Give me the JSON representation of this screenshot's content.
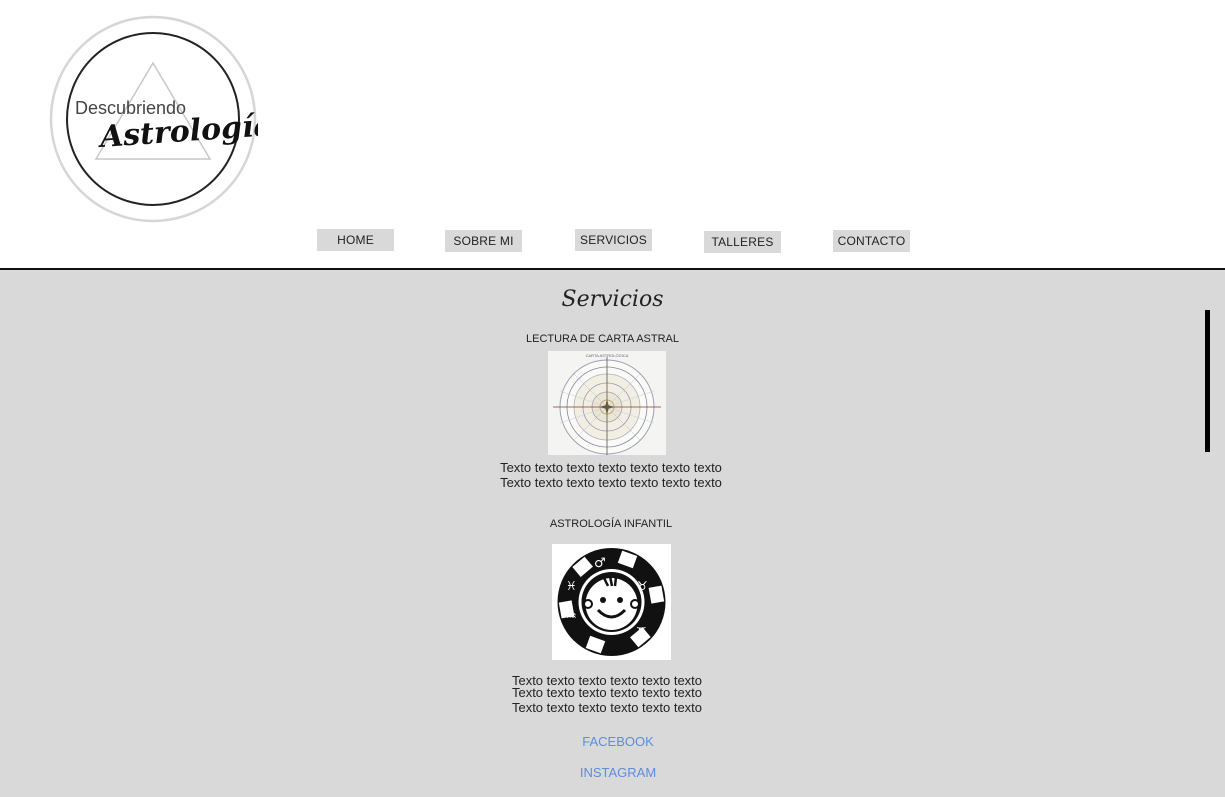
{
  "nav": {
    "items": [
      {
        "label": "HOME"
      },
      {
        "label": "SOBRE MI"
      },
      {
        "label": "SERVICIOS"
      },
      {
        "label": "TALLERES"
      },
      {
        "label": "CONTACTO"
      }
    ]
  },
  "main": {
    "title": "Servicios",
    "services": [
      {
        "heading": "LECTURA DE CARTA ASTRAL",
        "image_icon": "astral-chart-wheel",
        "lines": [
          "Texto texto texto texto texto texto texto",
          "Texto texto texto texto texto texto texto"
        ]
      },
      {
        "heading": "ASTROLOGÍA INFANTIL",
        "image_icon": "child-zodiac-wheel",
        "lines": [
          "Texto texto texto texto texto texto",
          "Texto texto texto texto texto texto",
          "Texto texto texto texto texto texto"
        ]
      }
    ]
  },
  "social": {
    "facebook": "FACEBOOK",
    "instagram": "INSTAGRAM"
  },
  "colors": {
    "content_bg": "#d9d9d9",
    "nav_bg": "#d9d9d9",
    "link": "#5b8de0",
    "divider": "#111111"
  }
}
